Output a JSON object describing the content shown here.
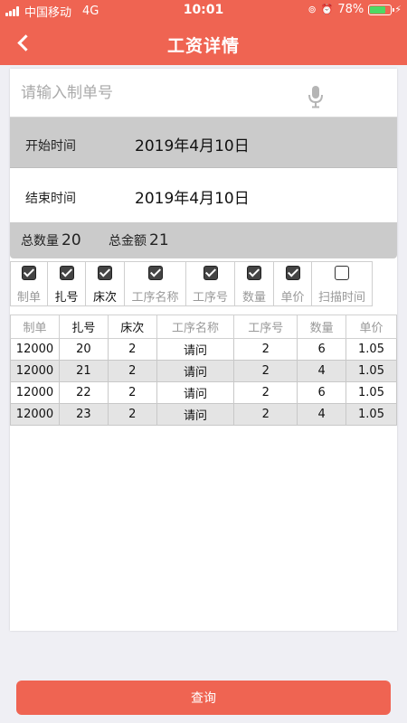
{
  "status_bar": {
    "carrier": "中国移动",
    "network": "4G",
    "time": "10:01",
    "battery": "78%",
    "battery_level": 0.78
  },
  "header": {
    "title": "工资详情"
  },
  "search": {
    "placeholder": "请输入制单号",
    "value": ""
  },
  "dates": {
    "start_label": "开始时间",
    "start_value": "2019年4月10日",
    "end_label": "结束时间",
    "end_value": "2019年4月10日"
  },
  "summary": {
    "total_qty_label": "总数量",
    "total_qty": "20",
    "total_amount_label": "总金额",
    "total_amount": "21"
  },
  "columns_toggle": [
    {
      "label": "制单",
      "checked": true
    },
    {
      "label": "扎号",
      "checked": true
    },
    {
      "label": "床次",
      "checked": true
    },
    {
      "label": "工序名称",
      "checked": true
    },
    {
      "label": "工序号",
      "checked": true
    },
    {
      "label": "数量",
      "checked": true
    },
    {
      "label": "单价",
      "checked": true
    },
    {
      "label": "扫描时间",
      "checked": false
    }
  ],
  "table": {
    "headers": [
      "制单",
      "扎号",
      "床次",
      "工序名称",
      "工序号",
      "数量",
      "单价"
    ],
    "rows": [
      [
        "12000",
        "20",
        "2",
        "请问",
        "2",
        "6",
        "1.05"
      ],
      [
        "12000",
        "21",
        "2",
        "请问",
        "2",
        "4",
        "1.05"
      ],
      [
        "12000",
        "22",
        "2",
        "请问",
        "2",
        "6",
        "1.05"
      ],
      [
        "12000",
        "23",
        "2",
        "请问",
        "2",
        "4",
        "1.05"
      ]
    ]
  },
  "footer": {
    "query_label": "查询"
  },
  "colors": {
    "accent": "#ef6452",
    "gray_band": "#cbcbcb",
    "background": "#efeff4"
  }
}
